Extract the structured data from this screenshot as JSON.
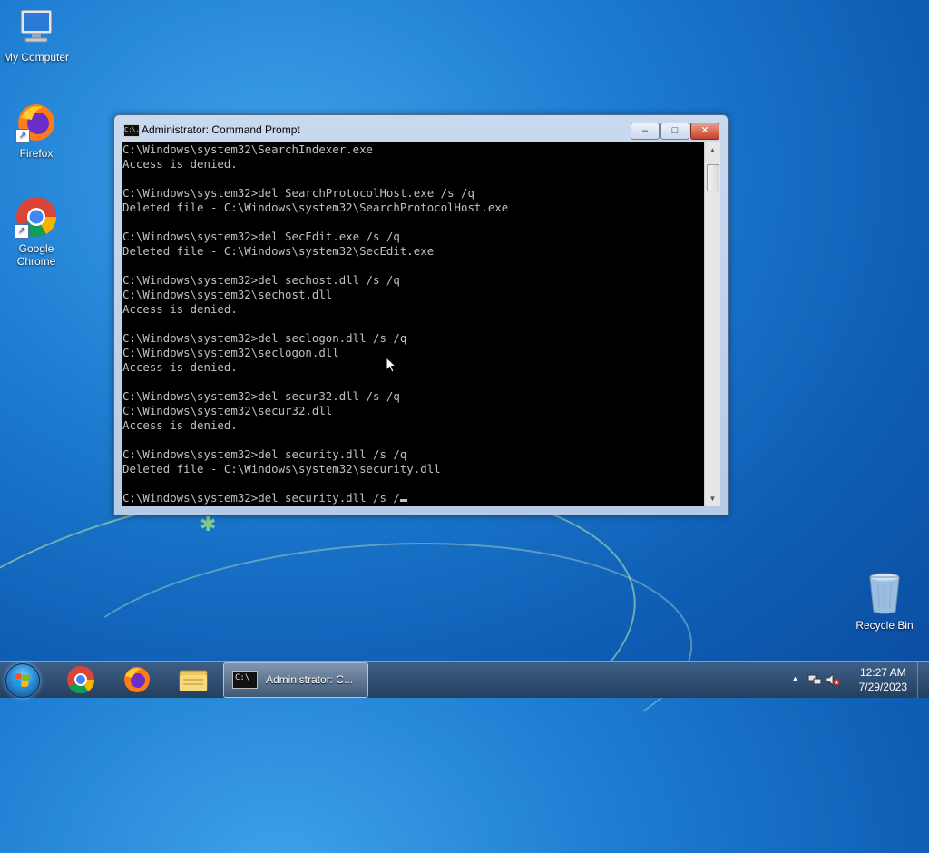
{
  "desktop": {
    "icons": [
      {
        "label": "My Computer"
      },
      {
        "label": "Firefox"
      },
      {
        "label": "Google Chrome"
      },
      {
        "label": "Recycle Bin"
      }
    ]
  },
  "window": {
    "title": "Administrator:  Command Prompt",
    "icon_text": "C:\\.",
    "minimize_glyph": "–",
    "maximize_glyph": "□",
    "close_glyph": "✕"
  },
  "console": {
    "lines": [
      "C:\\Windows\\system32\\SearchIndexer.exe",
      "Access is denied.",
      "",
      "C:\\Windows\\system32>del SearchProtocolHost.exe /s /q",
      "Deleted file - C:\\Windows\\system32\\SearchProtocolHost.exe",
      "",
      "C:\\Windows\\system32>del SecEdit.exe /s /q",
      "Deleted file - C:\\Windows\\system32\\SecEdit.exe",
      "",
      "C:\\Windows\\system32>del sechost.dll /s /q",
      "C:\\Windows\\system32\\sechost.dll",
      "Access is denied.",
      "",
      "C:\\Windows\\system32>del seclogon.dll /s /q",
      "C:\\Windows\\system32\\seclogon.dll",
      "Access is denied.",
      "",
      "C:\\Windows\\system32>del secur32.dll /s /q",
      "C:\\Windows\\system32\\secur32.dll",
      "Access is denied.",
      "",
      "C:\\Windows\\system32>del security.dll /s /q",
      "Deleted file - C:\\Windows\\system32\\security.dll",
      ""
    ],
    "current_input": "C:\\Windows\\system32>del security.dll /s /"
  },
  "taskbar": {
    "pinned": [
      {
        "name": "chrome"
      },
      {
        "name": "firefox"
      },
      {
        "name": "file-explorer"
      }
    ],
    "active_task_label": "Administrator:  C...",
    "task_icon_text": "C:\\_",
    "tray_chevron": "▲",
    "clock_time": "12:27 AM",
    "clock_date": "7/29/2023"
  }
}
